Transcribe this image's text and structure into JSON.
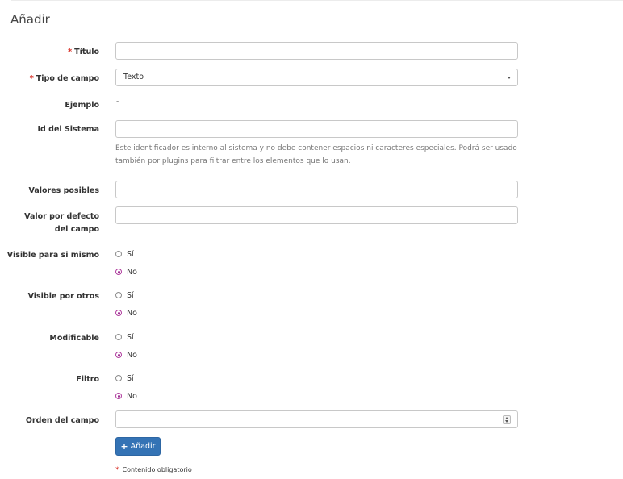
{
  "page": {
    "title": "Añadir"
  },
  "form": {
    "required_mark": "*",
    "titulo": {
      "label": "Título",
      "value": ""
    },
    "tipo": {
      "label": "Tipo de campo",
      "selected": "Texto"
    },
    "ejemplo": {
      "label": "Ejemplo",
      "value": "-"
    },
    "id_sistema": {
      "label": "Id del Sistema",
      "value": "",
      "help": "Este identificador es interno al sistema y no debe contener espacios ni caracteres especiales. Podrá ser usado también por plugins para filtrar entre los elementos que lo usan."
    },
    "valores": {
      "label": "Valores posibles",
      "value": ""
    },
    "defecto": {
      "label": "Valor por defecto del campo",
      "value": ""
    },
    "radio_groups": [
      {
        "label": "Visible para si mismo",
        "options": [
          "Sí",
          "No"
        ],
        "selected": "No"
      },
      {
        "label": "Visible por otros",
        "options": [
          "Sí",
          "No"
        ],
        "selected": "No"
      },
      {
        "label": "Modificable",
        "options": [
          "Sí",
          "No"
        ],
        "selected": "No"
      },
      {
        "label": "Filtro",
        "options": [
          "Sí",
          "No"
        ],
        "selected": "No"
      }
    ],
    "orden": {
      "label": "Orden del campo",
      "value": ""
    },
    "submit_label": "Añadir",
    "required_note": "Contenido obligatorio"
  },
  "colors": {
    "primary_button": "#3473b5",
    "required_mark": "#d9342b",
    "radio_accent": "#9c2b90"
  },
  "icons": {
    "submit": "plus-icon",
    "select": "chevron-down-icon",
    "number": "spinner-icon"
  }
}
